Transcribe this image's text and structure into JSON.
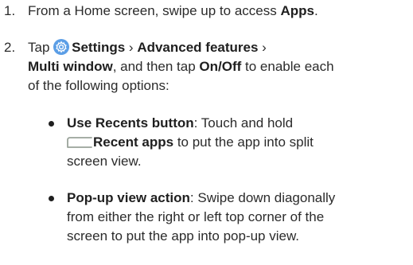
{
  "steps": [
    {
      "number": "1.",
      "prefix": "From a Home screen, swipe up to access ",
      "bold": "Apps",
      "suffix": "."
    },
    {
      "number": "2.",
      "tap": "Tap ",
      "settings": "Settings",
      "sep1": " › ",
      "advanced": "Advanced features",
      "sep2": " ›",
      "multi": "Multi window",
      "mid": ", and then tap ",
      "onoff": "On/Off",
      "rest1": " to enable each",
      "rest2": "of the following options:"
    }
  ],
  "bullets": [
    {
      "title": "Use Recents button",
      "line1": ": Touch and hold",
      "recent_label": "Recent apps",
      "line2": " to put the app into split",
      "line3": "screen view."
    },
    {
      "title": "Pop-up view action",
      "line1": ": Swipe down diagonally",
      "line2": "from either the right or left top corner of the",
      "line3": "screen to put the app into pop-up view."
    }
  ],
  "colors": {
    "settings_icon_bg": "#5b9ee6",
    "text": "#2b2b2b"
  },
  "icons": [
    "settings-gear-icon",
    "recent-apps-icon"
  ]
}
